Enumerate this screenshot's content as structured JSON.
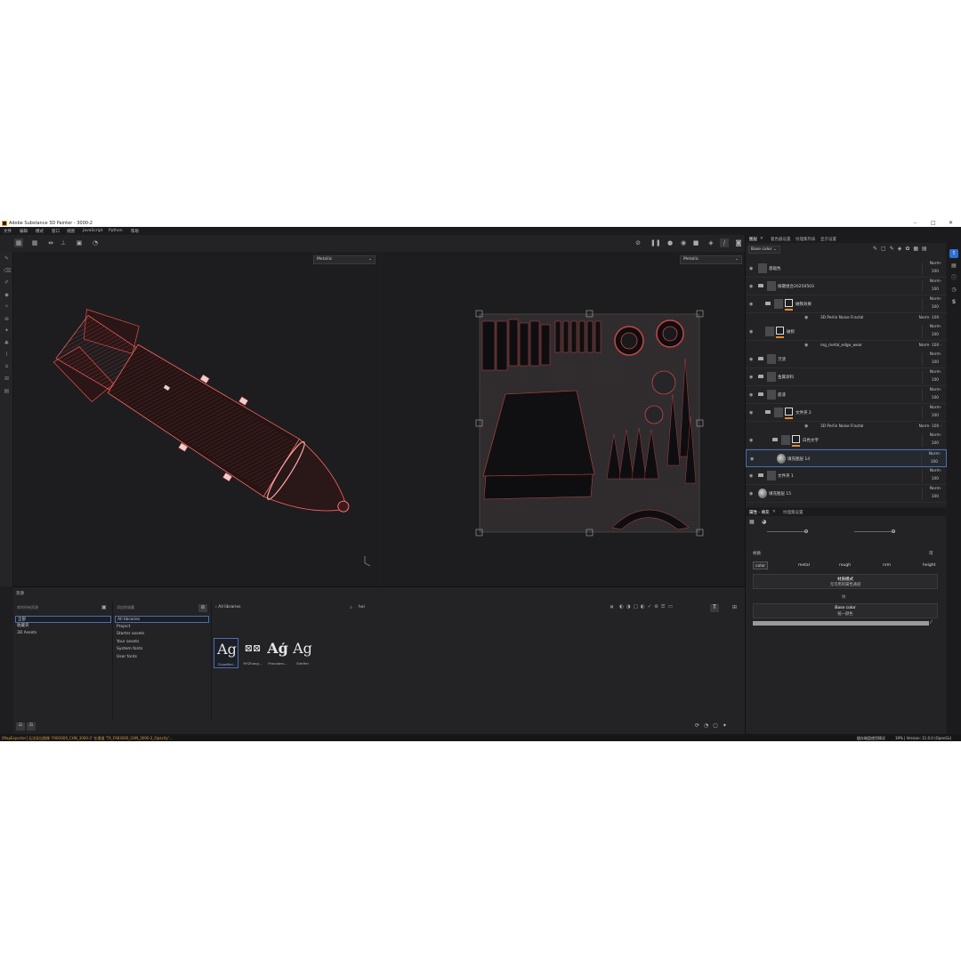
{
  "window": {
    "title": "Adobe Substance 3D Painter - 3000-2",
    "minimize": "–",
    "maximize": "□",
    "close": "✕"
  },
  "menu": [
    "文件",
    "编辑",
    "模式",
    "窗口",
    "视图",
    "JavaScript",
    "Python",
    "帮助"
  ],
  "viewport3d": {
    "channel": "Metallic"
  },
  "viewport2d": {
    "channel": "Metallic"
  },
  "layers_panel": {
    "tabs": [
      "图层",
      "着色器设置",
      "纹理集列表",
      "显示设置"
    ],
    "channel_select": "Base color",
    "layers": [
      {
        "name": "基础色",
        "blend": "Norm",
        "opacity": "100"
      },
      {
        "name": "按键组合20250503",
        "blend": "Norm",
        "opacity": "100"
      },
      {
        "name": "磁铁效果",
        "blend": "Norm",
        "opacity": "100"
      },
      {
        "name": "3D Perlin Noise Fractal",
        "blend": "Norm",
        "opacity": "100",
        "effect": true
      },
      {
        "name": "破损",
        "blend": "Norm",
        "opacity": "100"
      },
      {
        "name": "mg_metal_edge_wear",
        "blend": "Norm",
        "opacity": "100",
        "effect": true
      },
      {
        "name": "污渍",
        "blend": "Norm",
        "opacity": "100"
      },
      {
        "name": "金属涂料",
        "blend": "Norm",
        "opacity": "100"
      },
      {
        "name": "底漆",
        "blend": "Norm",
        "opacity": "100"
      },
      {
        "name": "文件夹 2",
        "blend": "Norm",
        "opacity": "100"
      },
      {
        "name": "3D Perlin Noise Fractal",
        "blend": "Norm",
        "opacity": "100",
        "effect": true
      },
      {
        "name": "白色文字",
        "blend": "Norm",
        "opacity": "100"
      },
      {
        "name": "填充图层 14",
        "blend": "Norm",
        "opacity": "100"
      },
      {
        "name": "文件夹 1",
        "blend": "Norm",
        "opacity": "100"
      },
      {
        "name": "填充图层 15",
        "blend": "Norm",
        "opacity": "100"
      }
    ]
  },
  "properties_panel": {
    "tabs": [
      "属性 - 填充",
      "纹理集设置"
    ],
    "section": "材质",
    "section_right": "司",
    "channels": [
      "color",
      "metal",
      "rough",
      "nrm",
      "height"
    ],
    "material_mode": {
      "title": "材质模式",
      "value": "无可用的属性通道"
    },
    "divider_label": "纹",
    "base_color": {
      "title": "Base color",
      "value": "统一颜色"
    }
  },
  "shelf": {
    "title": "资源",
    "col1": {
      "head": "库的所有资源",
      "items": [
        "全部",
        "收藏夹",
        "3D Assets"
      ]
    },
    "col2": {
      "head": "添加到收藏",
      "items": [
        "All libraries",
        "Project",
        "Starter assets",
        "Your assets",
        "System fonts",
        "User fonts"
      ]
    },
    "breadcrumb": "All libraries",
    "search_value": "hei",
    "assets": [
      {
        "glyph": "Ag",
        "name": "CloudHei..."
      },
      {
        "glyph": "⊠⊠",
        "name": "HYZhong..."
      },
      {
        "glyph": "Aģ",
        "name": "Pracxiam..."
      },
      {
        "glyph": "Ag",
        "name": "SimHei"
      }
    ]
  },
  "statusbar": {
    "left": "[MapExporter] 无法导出图像 'FAB3000_CHN_3000-2' 在通道 'TX_FAB3000_CHN_3000-2_Opacity'...",
    "right_msg": "缓存磁盘使用情况",
    "right": "19% | Version: 11.0.0 (OpenGL)"
  },
  "colors": {
    "accent": "#e88a2a",
    "selection": "#4a6fb0",
    "wireframe": "#ff5a5a",
    "bg": "#1e1e20"
  },
  "icons": [
    "paint-brush-icon",
    "eraser-icon",
    "projection-icon",
    "smudge-icon",
    "clone-icon",
    "eye-icon",
    "folder-icon",
    "trash-icon",
    "search-icon",
    "grid-icon",
    "camera-icon"
  ]
}
